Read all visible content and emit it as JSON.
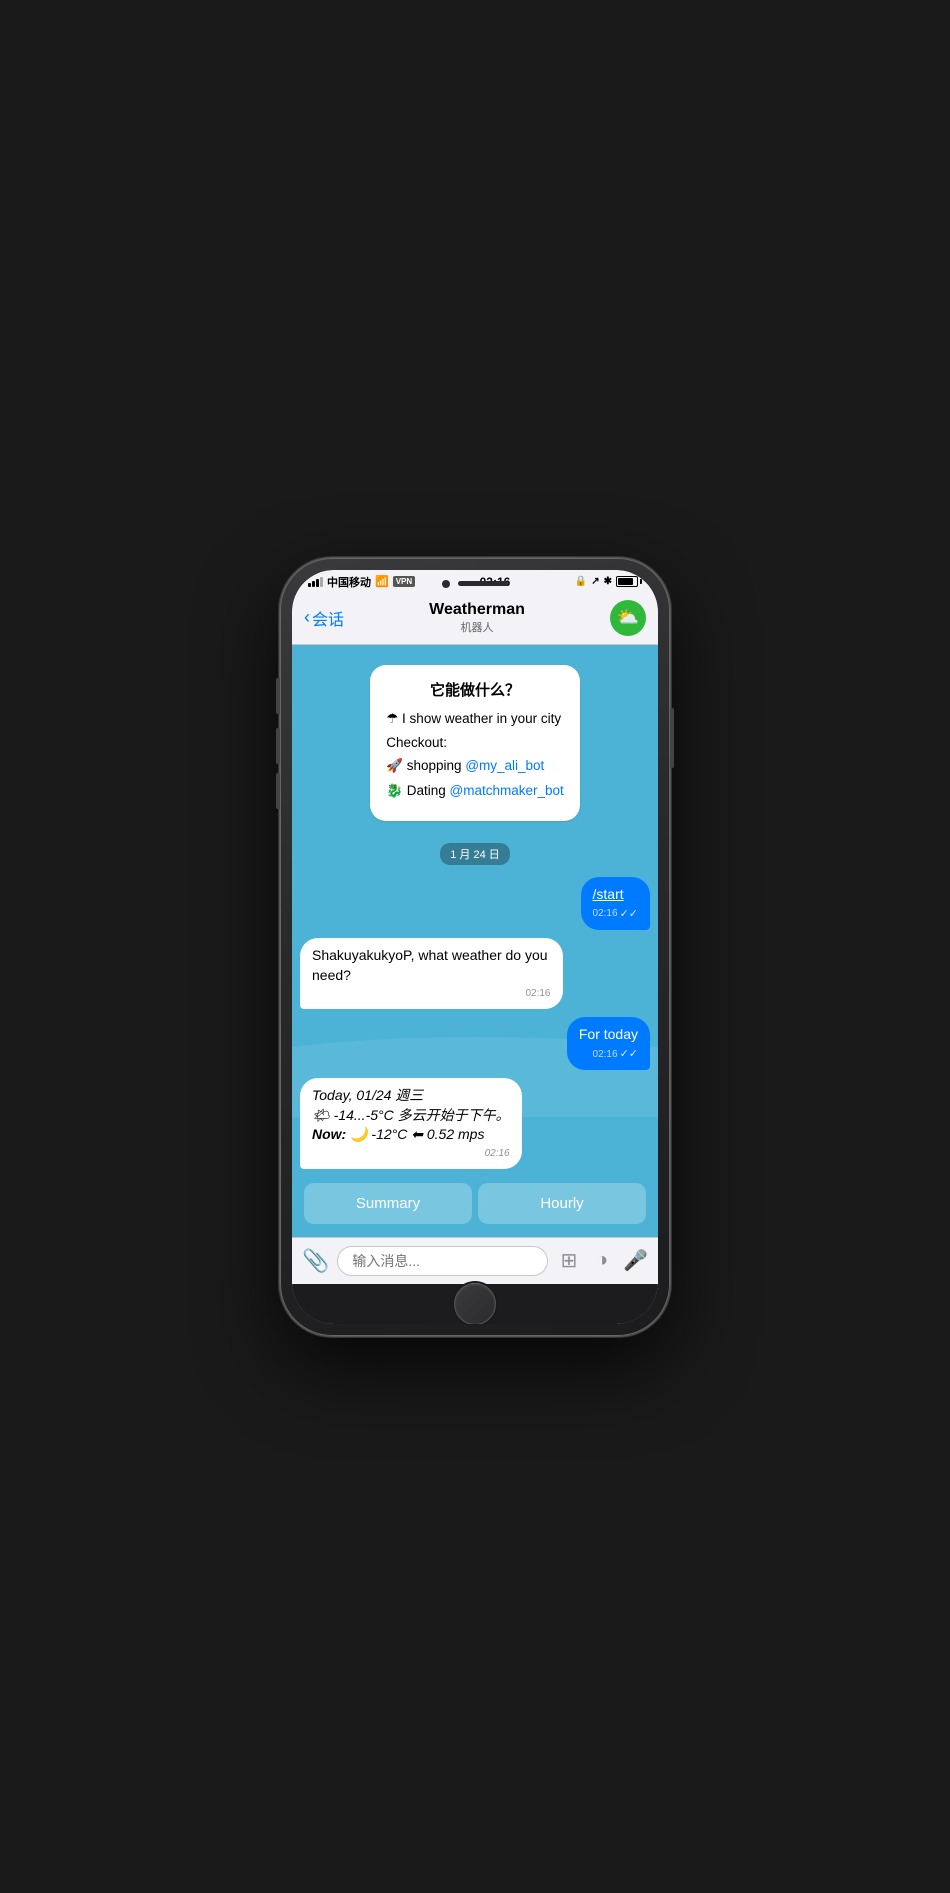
{
  "phone": {
    "status_bar": {
      "carrier": "中国移动",
      "wifi": "WiFi",
      "vpn": "VPN",
      "time": "02:16",
      "battery_level": "85%"
    },
    "nav": {
      "back_label": "会话",
      "title": "Weatherman",
      "subtitle": "机器人",
      "avatar_emoji": "⛅"
    },
    "chat": {
      "welcome": {
        "title": "它能做什么？",
        "line1": "☂ I show weather in your city",
        "checkout_label": "Checkout:",
        "shopping_line": "🚀 shopping ",
        "shopping_link": "@my_ali_bot",
        "dating_line": "🐉 Dating ",
        "dating_link": "@matchmaker_bot"
      },
      "date_stamp": "1 月 24 日",
      "messages": [
        {
          "id": "msg1",
          "type": "sent",
          "text": "/start",
          "time": "02:16",
          "checks": "✓✓"
        },
        {
          "id": "msg2",
          "type": "received",
          "text": "ShakuyakukyoP, what weather do you need?",
          "time": "02:16"
        },
        {
          "id": "msg3",
          "type": "sent",
          "text": "For today",
          "time": "02:16",
          "checks": "✓✓"
        },
        {
          "id": "msg4",
          "type": "received",
          "italic": true,
          "line1": "Today, 01/24 週三",
          "line2": "🌤 -14...-5°C 多云开始于下午。",
          "line3_bold": "Now:",
          "line3": " 🌙 -12°C ⬅ 0.52 mps",
          "time": "02:16"
        }
      ],
      "quick_replies": [
        {
          "id": "summary",
          "label": "Summary"
        },
        {
          "id": "hourly",
          "label": "Hourly"
        }
      ],
      "input_placeholder": "输入消息..."
    }
  }
}
